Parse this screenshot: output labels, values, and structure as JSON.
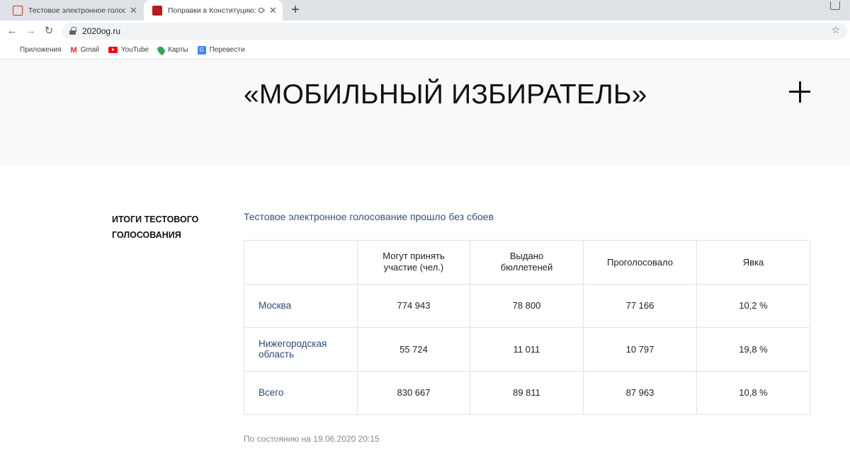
{
  "browser": {
    "tabs": [
      {
        "title": "Тестовое электронное голосовани",
        "active": false
      },
      {
        "title": "Поправки в Конституцию: Общеро",
        "active": true
      }
    ],
    "url": "2020og.ru",
    "bookmarks": [
      {
        "label": "Приложения",
        "icon": "apps-grid-icon"
      },
      {
        "label": "Gmail",
        "icon": "gmail-icon"
      },
      {
        "label": "YouTube",
        "icon": "youtube-icon"
      },
      {
        "label": "Карты",
        "icon": "maps-icon"
      },
      {
        "label": "Перевести",
        "icon": "translate-icon"
      }
    ]
  },
  "hero": {
    "title": "«МОБИЛЬНЫЙ ИЗБИРАТЕЛЬ»"
  },
  "section": {
    "heading_line1": "ИТОГИ ТЕСТОВОГО",
    "heading_line2": "ГОЛОСОВАНИЯ",
    "subtitle": "Тестовое электронное голосование прошло без сбоев",
    "columns": [
      "",
      "Могут принять участие (чел.)",
      "Выдано бюллетеней",
      "Проголосовало",
      "Явка"
    ],
    "rows": [
      {
        "region": "Москва",
        "eligible": "774 943",
        "issued": "78 800",
        "voted": "77 166",
        "turnout": "10,2 %"
      },
      {
        "region": "Нижегородская область",
        "eligible": "55 724",
        "issued": "11 011",
        "voted": "10 797",
        "turnout": "19,8 %"
      },
      {
        "region": "Всего",
        "eligible": "830 667",
        "issued": "89 811",
        "voted": "87 963",
        "turnout": "10,8 %"
      }
    ],
    "as_of": "По состоянию на 19.06.2020 20:15"
  },
  "colors": {
    "accent_link": "#34507a",
    "hero_bg": "#f9f9f9"
  }
}
